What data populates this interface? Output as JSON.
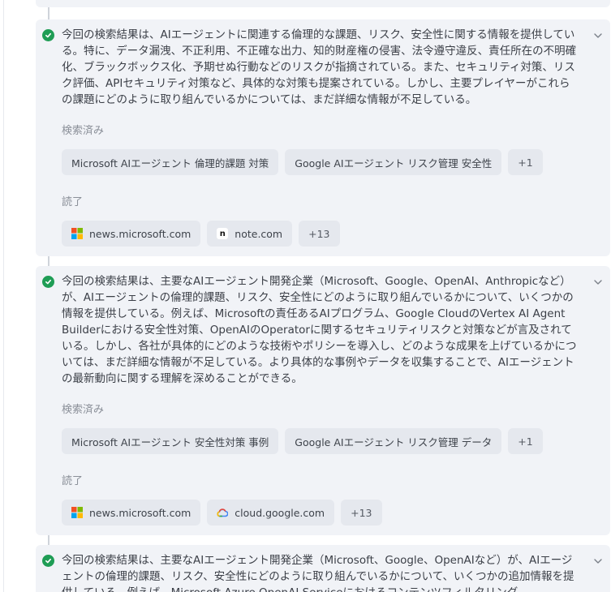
{
  "labels": {
    "searched": "検索済み",
    "read": "読了"
  },
  "results": [
    {
      "summary": "今回の検索結果は、AIエージェントに関連する倫理的な課題、リスク、安全性に関する情報を提供している。特に、データ漏洩、不正利用、不正確な出力、知的財産権の侵害、法令遵守違反、責任所在の不明確化、ブラックボックス化、予期せぬ行動などのリスクが指摘されている。また、セキュリティ対策、リスク評価、APIセキュリティ対策など、具体的な対策も提案されている。しかし、主要プレイヤーがこれらの課題にどのように取り組んでいるかについては、まだ詳細な情報が不足している。",
      "queries": [
        "Microsoft AIエージェント 倫理的課題 対策",
        "Google AIエージェント リスク管理 安全性"
      ],
      "queries_more": "+1",
      "sources": [
        {
          "domain": "news.microsoft.com",
          "icon": "microsoft-logo-icon"
        },
        {
          "domain": "note.com",
          "icon": "note-logo-icon"
        }
      ],
      "sources_more": "+13"
    },
    {
      "summary": "今回の検索結果は、主要なAIエージェント開発企業（Microsoft、Google、OpenAI、Anthropicなど）が、AIエージェントの倫理的課題、リスク、安全性にどのように取り組んでいるかについて、いくつかの情報を提供している。例えば、Microsoftの責任あるAIプログラム、Google CloudのVertex AI Agent Builderにおける安全性対策、OpenAIのOperatorに関するセキュリティリスクと対策などが言及されている。しかし、各社が具体的にどのような技術やポリシーを導入し、どのような成果を上げているかについては、まだ詳細な情報が不足している。より具体的な事例やデータを収集することで、AIエージェントの最新動向に関する理解を深めることができる。",
      "queries": [
        "Microsoft AIエージェント 安全性対策 事例",
        "Google AIエージェント リスク管理 データ"
      ],
      "queries_more": "+1",
      "sources": [
        {
          "domain": "news.microsoft.com",
          "icon": "microsoft-logo-icon"
        },
        {
          "domain": "cloud.google.com",
          "icon": "google-cloud-logo-icon"
        }
      ],
      "sources_more": "+13"
    },
    {
      "summary": "今回の検索結果は、主要なAIエージェント開発企業（Microsoft、Google、OpenAIなど）が、AIエージェントの倫理的課題、リスク、安全性にどのように取り組んでいるかについて、いくつかの追加情報を提供している。例えば、Microsoft Azure OpenAI Serviceにおけるコンテンツフィルタリング"
    }
  ],
  "colors": {
    "card_bg": "#f1f3f7",
    "chip_bg": "#e5e8ee",
    "check_green": "#1f9d55",
    "timeline": "#cfd3da"
  }
}
